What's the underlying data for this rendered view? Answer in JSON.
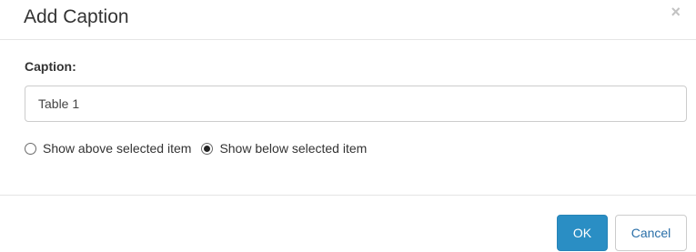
{
  "dialog": {
    "title": "Add Caption",
    "close_glyph": "×",
    "close_icon": "close-icon"
  },
  "caption": {
    "label": "Caption:",
    "value": "Table 1"
  },
  "position": {
    "options": [
      {
        "label": "Show above selected item",
        "selected": false
      },
      {
        "label": "Show below selected item",
        "selected": true
      }
    ]
  },
  "footer": {
    "ok_label": "OK",
    "cancel_label": "Cancel"
  },
  "colors": {
    "primary": "#2a8ec4",
    "link": "#2a6fa8"
  }
}
